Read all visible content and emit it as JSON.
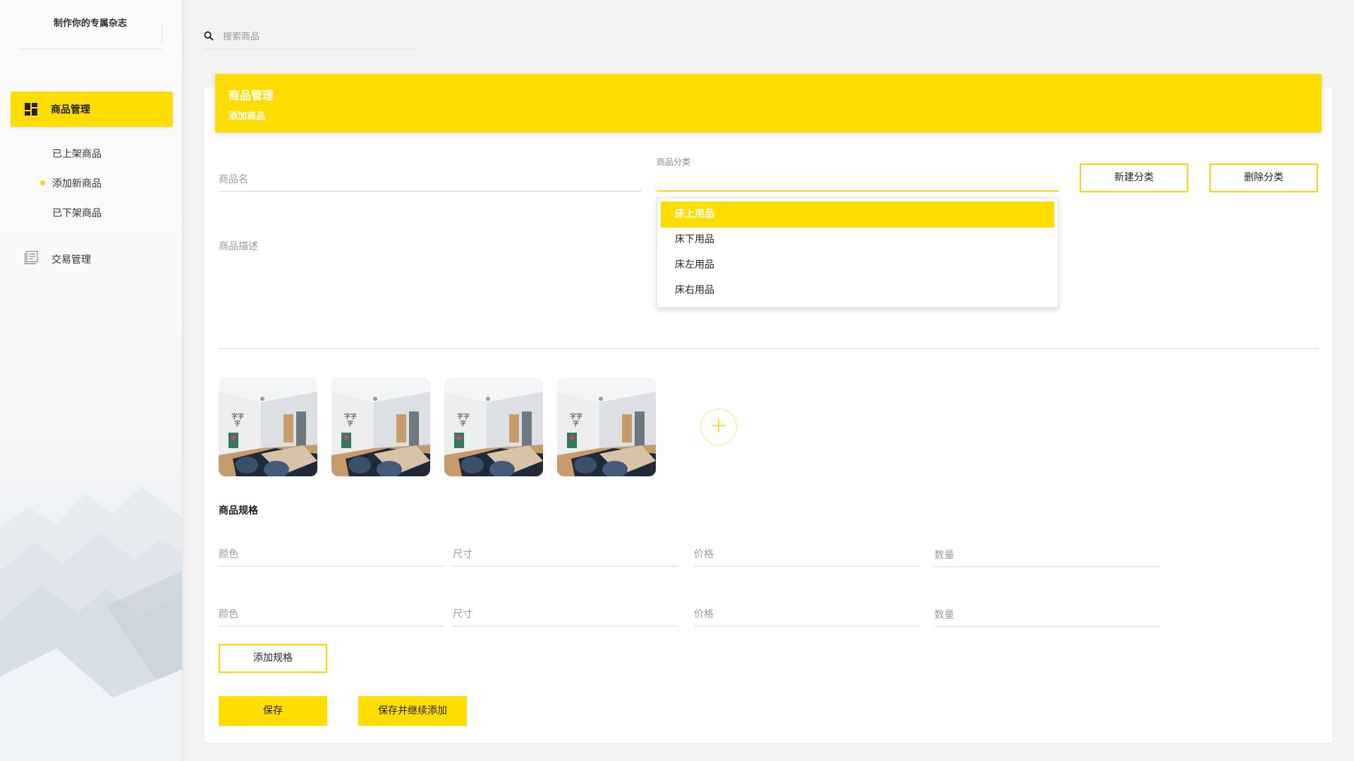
{
  "sidebar": {
    "brand": "制作你的专属杂志",
    "nav": {
      "goods": {
        "label": "商品管理",
        "icon": "dashboard-icon"
      },
      "trade": {
        "label": "交易管理",
        "icon": "document-list-icon"
      }
    },
    "sub_items": [
      "已上架商品",
      "添加新商品",
      "已下架商品"
    ],
    "active_sub_item": "添加新商品"
  },
  "search": {
    "placeholder": "搜索商品",
    "icon": "search-icon"
  },
  "header": {
    "title": "商品管理",
    "subtitle": "添加商品"
  },
  "form": {
    "name_placeholder": "商品名",
    "category_label": "商品分类",
    "category_value": "",
    "new_category_label": "新建分类",
    "delete_category_label": "删除分类",
    "description_placeholder": "商品描述",
    "category_options": [
      "床上用品",
      "床下用品",
      "床左用品",
      "床右用品"
    ],
    "selected_option": "床上用品"
  },
  "spec": {
    "title": "商品规格",
    "rows": [
      {
        "color": "颜色",
        "size": "尺寸",
        "price": "价格",
        "quantity": "数量"
      },
      {
        "color": "颜色",
        "size": "尺寸",
        "price": "价格",
        "quantity": "数量"
      }
    ],
    "add_spec_label": "添加规格"
  },
  "actions": {
    "save_label": "保存",
    "save_continue_label": "保存并继续添加"
  },
  "colors": {
    "accent": "#ffdd00",
    "accent_line": "#ffd400"
  }
}
